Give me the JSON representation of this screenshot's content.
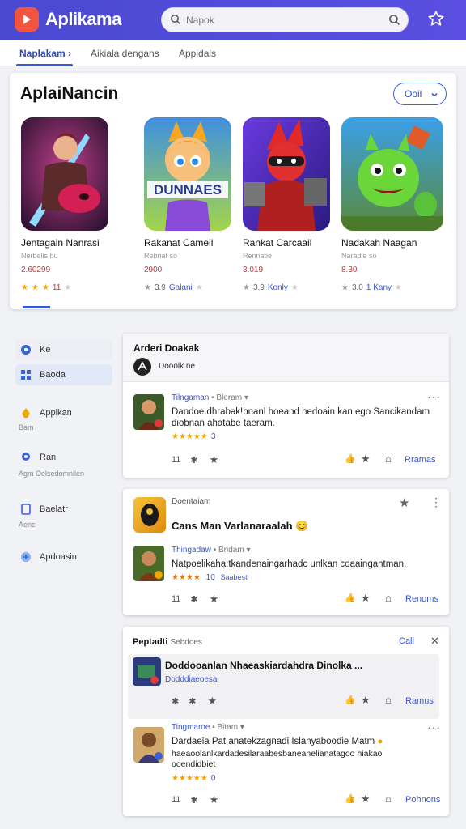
{
  "app": {
    "title": "Aplikama"
  },
  "search": {
    "placeholder": "Napok"
  },
  "nav": {
    "tabs": [
      {
        "label": "Naplakam"
      },
      {
        "label": "Aikiala dengans"
      },
      {
        "label": "Appidals"
      }
    ]
  },
  "featured": {
    "title": "AplaiNancin",
    "button_label": "Ooil",
    "cards": [
      {
        "name": "Jentagain Nanrasi",
        "sub": "Nerbelis bu",
        "price": "2.60299",
        "rating": "11"
      },
      {
        "name": "Rakanat Cameil",
        "sub": "Rebnat so",
        "price": "2900",
        "rating": "3.9",
        "rating_text": "Galani"
      },
      {
        "name": "Rankat Carcaail",
        "sub": "Rennatie",
        "price": "3.019",
        "rating": "3.9",
        "rating_text": "Konly"
      },
      {
        "name": "Nadakah Naagan",
        "sub": "Naradie so",
        "price": "8.30",
        "rating": "3.0",
        "rating_text": "1 Kany"
      }
    ]
  },
  "sidebar": {
    "items": [
      {
        "label": "Ke"
      },
      {
        "label": "Baoda"
      },
      {
        "label": "Applkan",
        "sub": "Bam"
      },
      {
        "label": "Ran",
        "sub": "Agm  Oelsedomnilen"
      },
      {
        "label": "Baelatr",
        "sub": "Aenc"
      },
      {
        "label": "Apdoasin"
      }
    ]
  },
  "panel1": {
    "title": "Arderi Doakak",
    "subtitle": "Dooolk ne",
    "meta_name": "Tilngaman",
    "meta_sep": "Bleram",
    "text1": "Dandoe.dhrabak!bnanl hoeand hedoain kan ego Sancikandam",
    "text2": "diobnan ahatabe taeram.",
    "stars_num": "3",
    "likes": "11",
    "link": "Rramas"
  },
  "panel2": {
    "header": "Doentaiam",
    "title": "Cans Man Varlanaraalah",
    "meta_name": "Thingadaw",
    "meta_sep": "Bridam",
    "text": "Natpoelikaha:tkandenaingarhadc unlkan coaaingantman.",
    "stars_num": "10",
    "stars_txt": "Saabest",
    "likes": "11",
    "link": "Renoms"
  },
  "panel3": {
    "title": "Peptadti",
    "title_sub": "Sebdoes",
    "call": "Call",
    "q_title": "Doddooanlan Nhaeaskiardahdra Dinolka ...",
    "q_sub": "Dodddiaeoesa",
    "link1": "Ramus",
    "meta_name": "Tingmaroe",
    "meta_sep": "Bitam",
    "text1": "Dardaeia Pat anatekzagnadi Islanyaboodie Matm",
    "text2": "haeaoolanlkardadesilaraabesbaneanelianatagoo hiakao",
    "text3": "ooendidbiet",
    "stars_num": "0",
    "likes": "11",
    "link2": "Pohnons"
  },
  "colors": {
    "brand": "#4a49d0",
    "accent": "#3a56d6",
    "logo": "#f1543f",
    "star": "#f2a500"
  }
}
